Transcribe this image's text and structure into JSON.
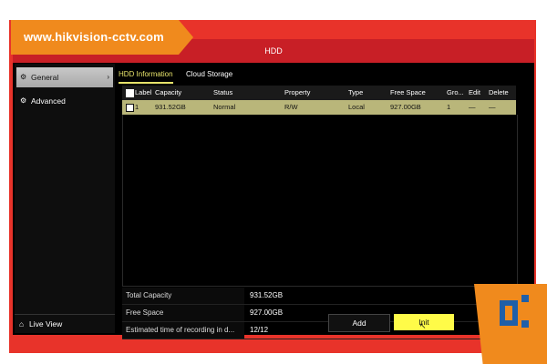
{
  "banner": {
    "text": "www.hikvision-cctv.com"
  },
  "window": {
    "title": "HDD"
  },
  "sidebar": {
    "items": [
      {
        "label": "General",
        "icon": "gear-icon",
        "active": true
      },
      {
        "label": "Advanced",
        "icon": "gear-icon",
        "active": false
      }
    ],
    "live_view": "Live View"
  },
  "tabs": [
    {
      "label": "HDD Information",
      "active": true
    },
    {
      "label": "Cloud Storage",
      "active": false
    }
  ],
  "table": {
    "headers": [
      "Label",
      "Capacity",
      "Status",
      "Property",
      "Type",
      "Free Space",
      "Gro...",
      "Edit",
      "Delete"
    ],
    "rows": [
      {
        "label": "1",
        "capacity": "931.52GB",
        "status": "Normal",
        "property": "R/W",
        "type": "Local",
        "free_space": "927.00GB",
        "group": "1",
        "edit": "—",
        "delete": "—"
      }
    ]
  },
  "summary": [
    {
      "label": "Total Capacity",
      "value": "931.52GB"
    },
    {
      "label": "Free Space",
      "value": "927.00GB"
    },
    {
      "label": "Estimated time of recording in d...",
      "value": "12/12"
    }
  ],
  "buttons": {
    "add": "Add",
    "init": "Init"
  },
  "colors": {
    "accent": "#e8332a",
    "banner": "#f08a1d",
    "selection": "#b9b67a",
    "init_button": "#fffb48"
  }
}
